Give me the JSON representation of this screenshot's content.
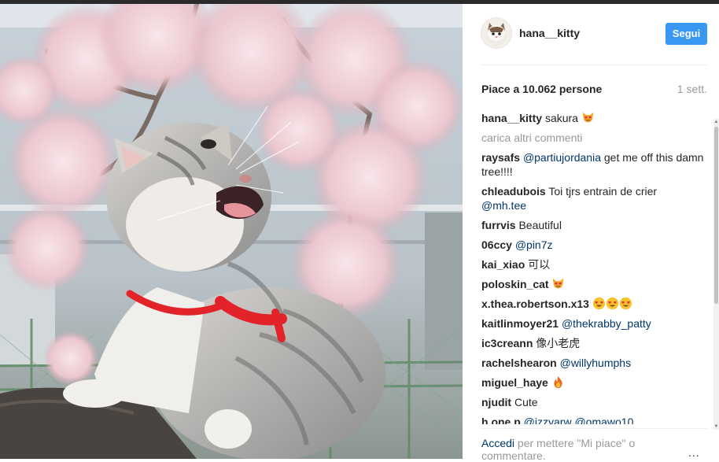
{
  "post": {
    "image_alt": "",
    "author": "hana__kitty",
    "follow_label": "Segui",
    "likes_text": "Piace a 10.062 persone",
    "time_ago": "1 sett.",
    "load_more": "carica altri commenti"
  },
  "caption": {
    "user": "hana__kitty",
    "text": "sakura",
    "emoji": "cat-heart-eyes"
  },
  "comments": [
    {
      "user": "raysafs",
      "mention": "@partiujordania",
      "text": " get me off this damn tree!!!!"
    },
    {
      "user": "chleadubois",
      "text": " Toi tjrs entrain de crier ",
      "mention": "@mh.tee"
    },
    {
      "user": "furrvis",
      "text": " Beautiful"
    },
    {
      "user": "06ccy",
      "mention": "@pin7z"
    },
    {
      "user": "kai_xiao",
      "text": " 可以"
    },
    {
      "user": "poloskin_cat",
      "emoji": "cat-heart-eyes"
    },
    {
      "user": "x.thea.robertson.x13",
      "emoji": "heart-eyes x3"
    },
    {
      "user": "kaitlinmoyer21",
      "mention": "@thekrabby_patty"
    },
    {
      "user": "ic3creann",
      "text": " 像小老虎"
    },
    {
      "user": "rachelshearon",
      "mention": "@willyhumphs"
    },
    {
      "user": "miguel_haye",
      "emoji": "fire"
    },
    {
      "user": "njudit",
      "text": " Cute"
    },
    {
      "user": "h.one.p",
      "mention": "@izzyarw",
      "text": " ",
      "mention2": "@omawo10"
    }
  ],
  "footer": {
    "login_link": "Accedi",
    "login_text": " per mettere \"Mi piace\" o commentare.",
    "more_label": "..."
  },
  "colors": {
    "follow_button": "#3897f0",
    "mention": "#003569",
    "muted_text": "#999999",
    "harness": "#e3232a"
  }
}
